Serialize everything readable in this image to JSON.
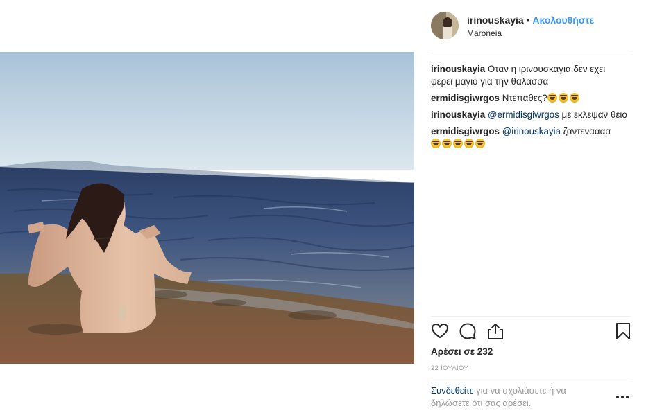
{
  "post": {
    "username": "irinouskayia",
    "separator": "•",
    "follow_label": "Ακολουθήστε",
    "location": "Maroneia"
  },
  "comments": [
    {
      "user": "irinouskayia",
      "text": "Οταν η ιρινουσκαγια δεν εχει φερει μαγιο για την θαλασσα",
      "mention": "",
      "emoji_count": 0
    },
    {
      "user": "ermidisgiwrgos",
      "text": "Ντεπαθες?",
      "mention": "",
      "emoji_count": 3
    },
    {
      "user": "irinouskayia",
      "mention": "@ermidisgiwrgos",
      "text": "με εκλεψαν θειο",
      "emoji_count": 0
    },
    {
      "user": "ermidisgiwrgos",
      "mention": "@irinouskayia",
      "text": "ζαντεναααα",
      "emoji_count": 5
    }
  ],
  "likes_label": "Αρέσει σε 232",
  "date": "22 ΙΟΥΛΙΟΥ",
  "login_prompt": {
    "link": "Συνδεθείτε",
    "text": "για να σχολιάσετε ή να δηλώσετε ότι σας αρέσει."
  },
  "icons": [
    "heart-icon",
    "comment-icon",
    "share-icon",
    "bookmark-icon",
    "more-options-icon"
  ],
  "colors": {
    "accent": "#3897f0",
    "mention": "#003569",
    "muted": "#999999",
    "text": "#262626"
  }
}
